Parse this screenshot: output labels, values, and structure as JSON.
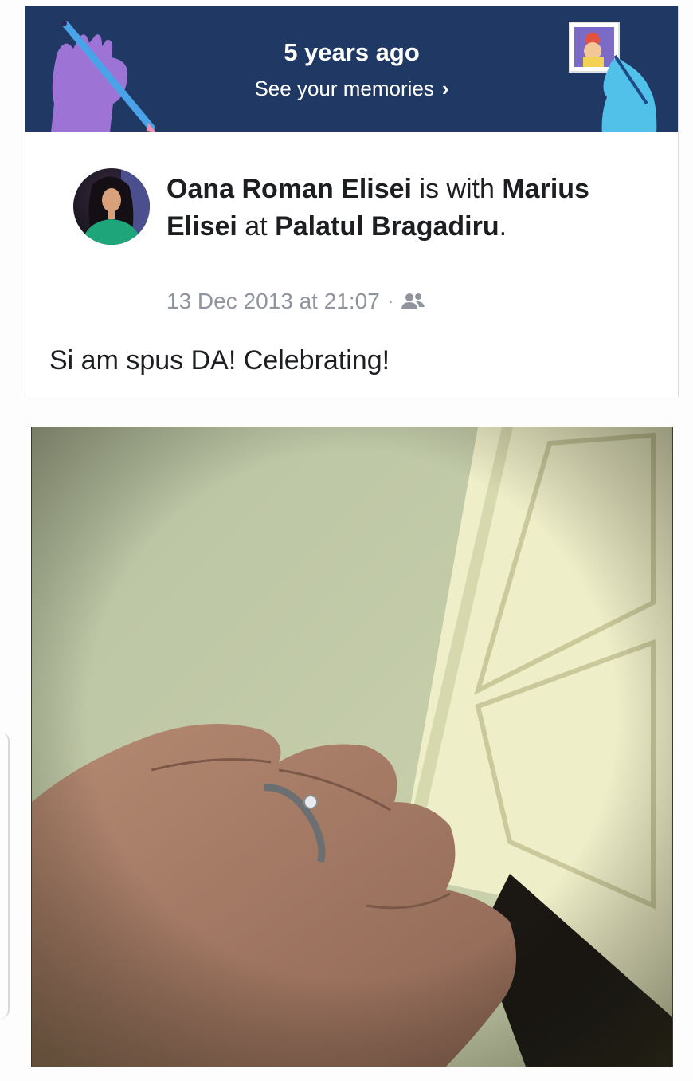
{
  "memory_banner": {
    "title": "5 years ago",
    "link_label": "See your memories",
    "chevron": "›",
    "background": "#203864"
  },
  "post": {
    "author": "Oana Roman Elisei",
    "with_text": " is with ",
    "tagged_person": "Marius Elisei",
    "at_text": " at ",
    "place": "Palatul Bragadiru",
    "period": ".",
    "timestamp": "13 Dec 2013 at 21:07",
    "separator": "·",
    "audience_icon": "friends-icon",
    "text": "Si am spus DA! Celebrating!"
  },
  "colors": {
    "text_primary": "#1c1e21",
    "text_secondary": "#90949c",
    "banner": "#203864"
  }
}
